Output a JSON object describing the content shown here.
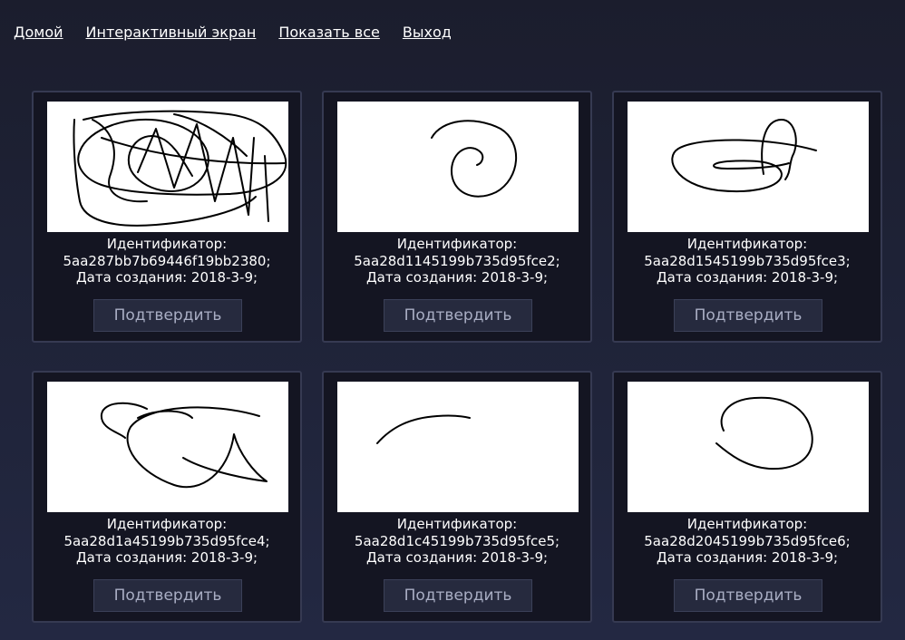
{
  "nav": {
    "home": "Домой",
    "interactive": "Интерактивный экран",
    "show_all": "Показать все",
    "logout": "Выход"
  },
  "cards": [
    {
      "id_label": "Идентификатор:",
      "id": "5aa287bb7b69446f19bb2380;",
      "date": "Дата создания: 2018-3-9;",
      "button": "Подтвердить"
    },
    {
      "id_label": "Идентификатор:",
      "id": "5aa28d1145199b735d95fce2;",
      "date": "Дата создания: 2018-3-9;",
      "button": "Подтвердить"
    },
    {
      "id_label": "Идентификатор:",
      "id": "5aa28d1545199b735d95fce3;",
      "date": "Дата создания: 2018-3-9;",
      "button": "Подтвердить"
    },
    {
      "id_label": "Идентификатор:",
      "id": "5aa28d1a45199b735d95fce4;",
      "date": "Дата создания: 2018-3-9;",
      "button": "Подтвердить"
    },
    {
      "id_label": "Идентификатор:",
      "id": "5aa28d1c45199b735d95fce5;",
      "date": "Дата создания: 2018-3-9;",
      "button": "Подтвердить"
    },
    {
      "id_label": "Идентификатор:",
      "id": "5aa28d2045199b735d95fce6;",
      "date": "Дата создания: 2018-3-9;",
      "button": "Подтвердить"
    }
  ]
}
